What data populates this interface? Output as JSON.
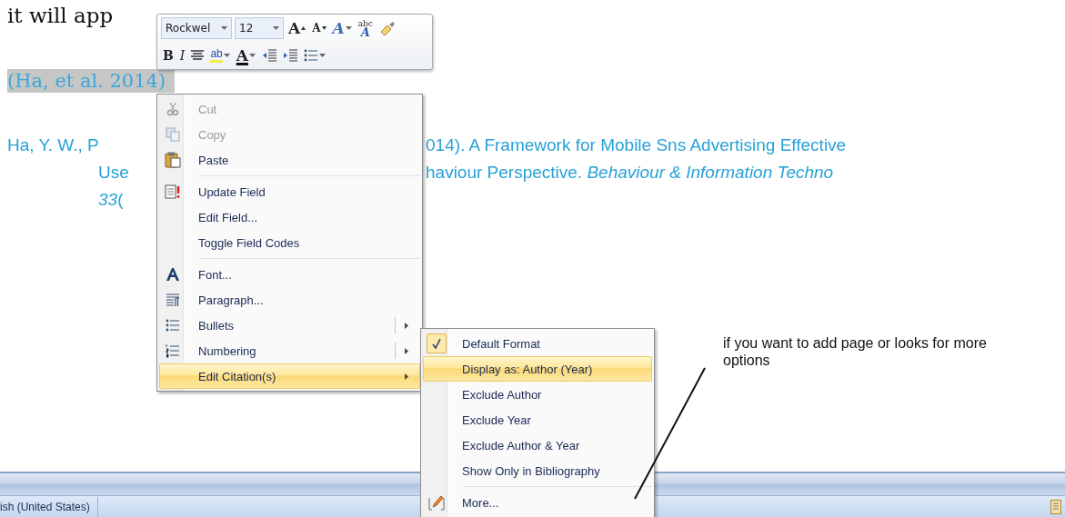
{
  "document": {
    "intro": "it will app",
    "citation": {
      "text": "(Ha, et al.  2014)",
      "selected": true
    },
    "reference": {
      "first_line": {
        "left": "Ha, Y. W., P",
        "right": "014). A Framework for Mobile Sns Advertising Effective"
      },
      "continuation_lines": [
        {
          "left": "Use",
          "right": "haviour  Perspective.  *Behaviour & Information Techno*"
        },
        {
          "left": "*33*("
        }
      ]
    }
  },
  "mini_toolbar": {
    "font": "Rockwel",
    "size": "12",
    "rows": [
      [
        {
          "kind": "grow_font",
          "label": "A"
        },
        {
          "kind": "shrink_font",
          "label": "A"
        },
        {
          "kind": "styles",
          "label": "A",
          "has_menu": true
        },
        {
          "kind": "change_case",
          "label": "abc",
          "sub": "A"
        },
        {
          "kind": "format_painter"
        }
      ],
      [
        {
          "kind": "bold",
          "label": "B"
        },
        {
          "kind": "italic",
          "label": "I"
        },
        {
          "kind": "center"
        },
        {
          "kind": "highlight",
          "label": "ab",
          "has_menu": true
        },
        {
          "kind": "font_color",
          "label": "A",
          "has_menu": true
        },
        {
          "kind": "decrease_indent"
        },
        {
          "kind": "increase_indent"
        },
        {
          "kind": "bullets",
          "has_menu": true
        }
      ]
    ]
  },
  "context_menu": {
    "items": [
      {
        "kind": "cut",
        "label": "Cut",
        "disabled": true,
        "highlighted": false,
        "submenu": false,
        "split": false
      },
      {
        "kind": "copy",
        "label": "Copy",
        "disabled": true,
        "highlighted": false,
        "submenu": false,
        "split": false
      },
      {
        "kind": "paste",
        "label": "Paste",
        "disabled": false,
        "highlighted": false,
        "submenu": false,
        "split": false
      },
      {
        "kind": "separator"
      },
      {
        "kind": "update_field",
        "label": "Update Field",
        "disabled": false,
        "highlighted": false,
        "submenu": false,
        "split": false
      },
      {
        "kind": "plain",
        "label": "Edit Field...",
        "disabled": false,
        "highlighted": false,
        "submenu": false,
        "split": false
      },
      {
        "kind": "plain",
        "label": "Toggle Field Codes",
        "disabled": false,
        "highlighted": false,
        "submenu": false,
        "split": false
      },
      {
        "kind": "separator"
      },
      {
        "kind": "font",
        "label": "Font...",
        "disabled": false,
        "highlighted": false,
        "submenu": false,
        "split": false
      },
      {
        "kind": "paragraph",
        "label": "Paragraph...",
        "disabled": false,
        "highlighted": false,
        "submenu": false,
        "split": false
      },
      {
        "kind": "bullets",
        "label": "Bullets",
        "disabled": false,
        "highlighted": false,
        "submenu": true,
        "split": true
      },
      {
        "kind": "numbering",
        "label": "Numbering",
        "disabled": false,
        "highlighted": false,
        "submenu": true,
        "split": true
      },
      {
        "kind": "plain",
        "label": "Edit Citation(s)",
        "disabled": false,
        "highlighted": true,
        "submenu": true,
        "split": false
      }
    ]
  },
  "submenu": {
    "items": [
      {
        "kind": "plain",
        "label": "Default Format",
        "checked": true,
        "highlighted": false
      },
      {
        "kind": "plain",
        "label": "Display as: Author (Year)",
        "checked": false,
        "highlighted": true
      },
      {
        "kind": "plain",
        "label": "Exclude Author",
        "checked": false,
        "highlighted": false
      },
      {
        "kind": "plain",
        "label": "Exclude Year",
        "checked": false,
        "highlighted": false
      },
      {
        "kind": "plain",
        "label": "Exclude Author & Year",
        "checked": false,
        "highlighted": false
      },
      {
        "kind": "plain",
        "label": "Show Only in Bibliography",
        "checked": false,
        "highlighted": false
      },
      {
        "kind": "separator"
      },
      {
        "kind": "more",
        "label": "More...",
        "checked": false,
        "highlighted": false
      }
    ]
  },
  "annotation": {
    "text": "if you want to add page or looks for more options"
  },
  "status_bar": {
    "language": "ish (United States)"
  }
}
